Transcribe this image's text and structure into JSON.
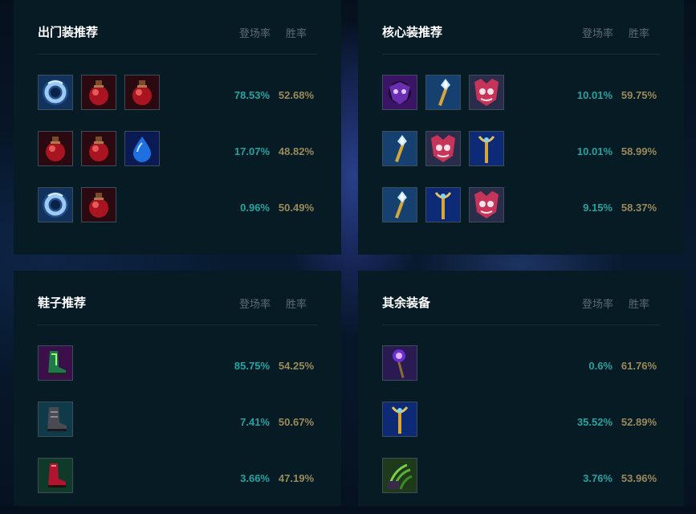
{
  "panels": [
    {
      "title": "出门装推荐",
      "col_pick": "登场率",
      "col_win": "胜率",
      "rows": [
        {
          "icons": [
            "tear-ring-icon",
            "health-potion-icon",
            "health-potion-icon"
          ],
          "pick": "78.53%",
          "win": "52.68%"
        },
        {
          "icons": [
            "health-potion-icon",
            "health-potion-icon",
            "blue-droplet-icon"
          ],
          "pick": "17.07%",
          "win": "48.82%"
        },
        {
          "icons": [
            "tear-ring-icon",
            "health-potion-icon"
          ],
          "pick": "0.96%",
          "win": "50.49%"
        }
      ]
    },
    {
      "title": "核心装推荐",
      "col_pick": "登场率",
      "col_win": "胜率",
      "rows": [
        {
          "icons": [
            "dark-mask-icon",
            "crystal-scepter-icon",
            "pink-mask-icon"
          ],
          "pick": "10.01%",
          "win": "59.75%"
        },
        {
          "icons": [
            "crystal-scepter-icon",
            "pink-mask-icon",
            "golden-staff-icon"
          ],
          "pick": "10.01%",
          "win": "58.99%"
        },
        {
          "icons": [
            "crystal-scepter-icon",
            "golden-staff-icon",
            "pink-mask-icon"
          ],
          "pick": "9.15%",
          "win": "58.37%"
        }
      ]
    },
    {
      "title": "鞋子推荐",
      "col_pick": "登场率",
      "col_win": "胜率",
      "rows": [
        {
          "icons": [
            "green-boots-icon"
          ],
          "pick": "85.75%",
          "win": "54.25%"
        },
        {
          "icons": [
            "armored-boots-icon"
          ],
          "pick": "7.41%",
          "win": "50.67%"
        },
        {
          "icons": [
            "red-boots-icon"
          ],
          "pick": "3.66%",
          "win": "47.19%"
        }
      ]
    },
    {
      "title": "其余装备",
      "col_pick": "登场率",
      "col_win": "胜率",
      "rows": [
        {
          "icons": [
            "void-staff-icon"
          ],
          "pick": "0.6%",
          "win": "61.76%"
        },
        {
          "icons": [
            "golden-staff-icon"
          ],
          "pick": "35.52%",
          "win": "52.89%"
        },
        {
          "icons": [
            "green-claw-icon"
          ],
          "pick": "3.76%",
          "win": "53.96%"
        }
      ]
    }
  ],
  "colors": {
    "pick": "#23a3a1",
    "win": "#9a8a5a",
    "panel_bg": "#071b25"
  }
}
